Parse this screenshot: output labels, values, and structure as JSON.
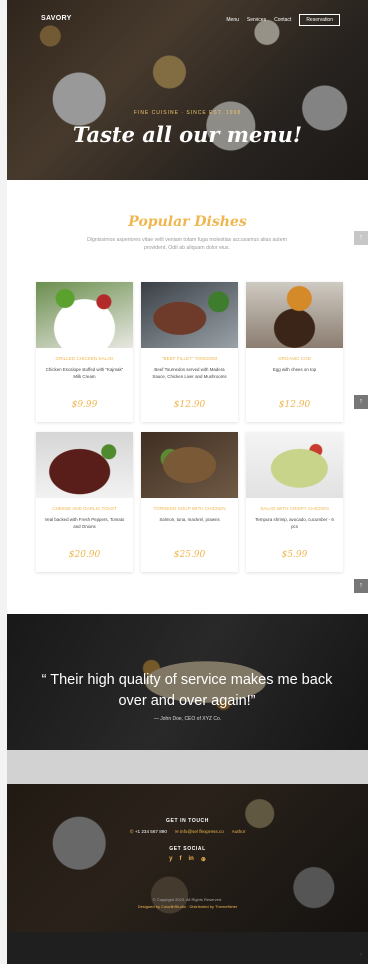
{
  "header": {
    "brand": "SAVORY",
    "nav": [
      "Menu",
      "Services",
      "Contact"
    ],
    "reserve_label": "Reservation"
  },
  "hero": {
    "subtitle": "FINE CUISINE · SINCE EST. 1998",
    "title": "Taste all our menu!"
  },
  "popular": {
    "title": "Popular Dishes",
    "description": "Dignissimos asperiores vitae velit veniam totam fuga molestias accusamus alias autem provident. Odit ab aliquam dolor eius.",
    "items": [
      {
        "name": "GRILLED CHICKEN SALAD",
        "desc": "Chicken Escalope stuffed with \"Kajmak\" Milk Cream",
        "price": "$9.99"
      },
      {
        "name": "\"BEEF FILLET\" TAKEDOM",
        "desc": "Beef Tournedos served with Madera Sauce, Chicken Liver and Mushrooms",
        "price": "$12.90"
      },
      {
        "name": "ORGANIC COD",
        "desc": "Egg with chees on top",
        "price": "$12.90"
      },
      {
        "name": "CHEESE AND GARLIC TOAST",
        "desc": "Veal backed with Fresh Peppers, Tomato and Onions",
        "price": "$20.90"
      },
      {
        "name": "TORNEDO SOUP WITH CHICKEN",
        "desc": "Salmon, tuna, mackrel, prawns",
        "price": "$25.90"
      },
      {
        "name": "SALAD WITH CRISPY CHICKEN",
        "desc": "Tempura shrimp, avocado, cucumber - 6 pcs",
        "price": "$5.99"
      }
    ]
  },
  "testimonial": {
    "quote": "“ Their high quality of service makes me back over and over again!”",
    "author": "— John Doe, CEO of XYZ Co."
  },
  "footer": {
    "touch_heading": "GET IN TOUCH",
    "phone": "+1 234 567 890",
    "email": "info@sel flexpress.co",
    "address": "Author",
    "social_heading": "GET SOCIAL",
    "social": [
      "y",
      "f",
      "in",
      "⊕"
    ],
    "copyright": "© Copyright 2023. All Rights Reserved.",
    "credit": "Designed by ColorlibStudio · Distributed by Themefisher"
  },
  "side_buttons": [
    "↑",
    "↑",
    "↑",
    "↑"
  ],
  "colors": {
    "accent": "#f0b64f",
    "dark": "#1f1f1f"
  }
}
